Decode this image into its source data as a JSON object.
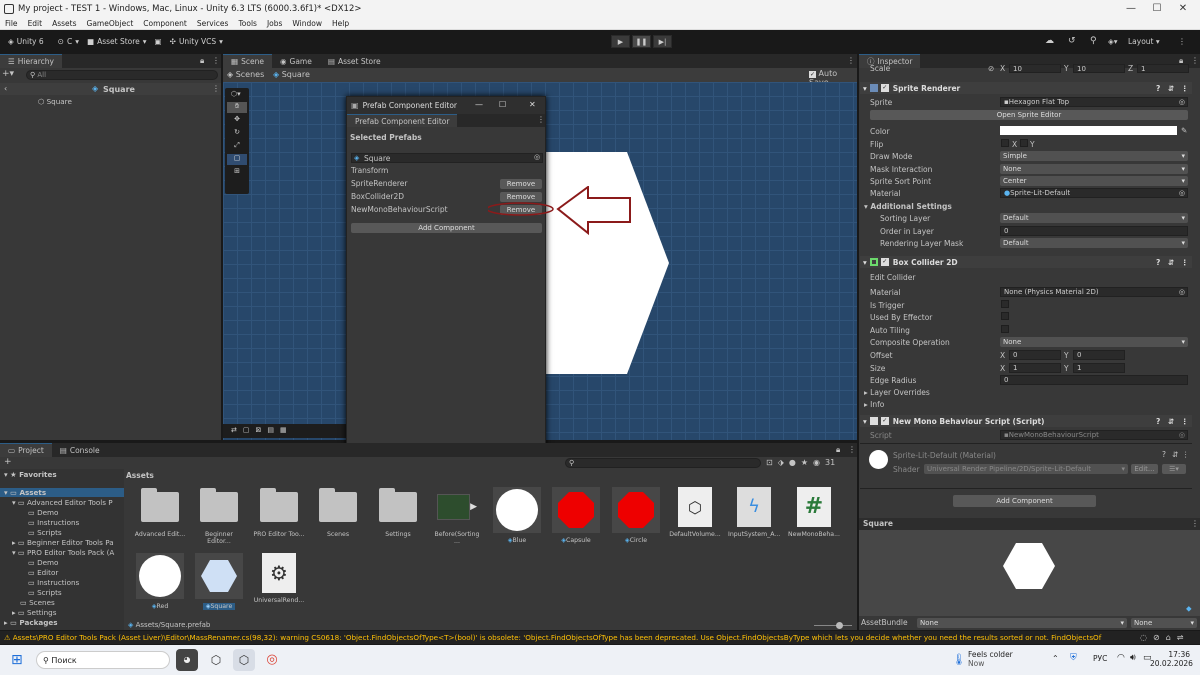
{
  "window": {
    "title": "My project - TEST 1 - Windows, Mac, Linux - Unity 6.3 LTS (6000.3.6f1)* <DX12>"
  },
  "menu": [
    "File",
    "Edit",
    "Assets",
    "GameObject",
    "Component",
    "Services",
    "Tools",
    "Jobs",
    "Window",
    "Help"
  ],
  "toolbar": {
    "unity": "Unity 6",
    "account": "C",
    "asset_store": "Asset Store",
    "vcs": "Unity VCS",
    "layout": "Layout"
  },
  "hierarchy": {
    "tab": "Hierarchy",
    "search": "All",
    "breadcrumb": "Square",
    "items": [
      "Square"
    ]
  },
  "scene": {
    "tabs": [
      "Scene",
      "Game",
      "Asset Store"
    ],
    "breadcrumb_scenes": "Scenes",
    "breadcrumb_obj": "Square",
    "auto_save": "Auto Save"
  },
  "dialog": {
    "title": "Prefab Component Editor",
    "tab": "Prefab Component Editor",
    "selected_label": "Selected Prefabs",
    "prefab": "Square",
    "components": [
      "Transform",
      "SpriteRenderer",
      "BoxCollider2D",
      "NewMonoBehaviourScript"
    ],
    "remove": "Remove",
    "add": "Add Component"
  },
  "project": {
    "tabs": [
      "Project",
      "Console"
    ],
    "breadcrumb": "Assets",
    "count": "31",
    "tree": [
      "Favorites",
      "Assets",
      "Advanced Editor Tools P",
      "Demo",
      "Instructions",
      "Scripts",
      "Beginner Editor Tools Pa",
      "PRO Editor Tools Pack (A",
      "Demo",
      "Editor",
      "Instructions",
      "Scripts",
      "Scenes",
      "Settings",
      "Packages"
    ],
    "assets": [
      "Advanced Edit...",
      "Beginner Editor...",
      "PRO Editor Too...",
      "Scenes",
      "Settings",
      "Before(Sorting ...",
      "Blue",
      "Capsule",
      "Circle",
      "DefaultVolume...",
      "InputSystem_A...",
      "NewMonoBeha...",
      "Red",
      "Square",
      "UniversalRend..."
    ],
    "footer": "Assets/Square.prefab"
  },
  "inspector": {
    "tab": "Inspector",
    "scale_label": "Scale",
    "scale": {
      "x": "10",
      "y": "10",
      "z": "1"
    },
    "sprite_renderer": {
      "title": "Sprite Renderer",
      "sprite_label": "Sprite",
      "sprite": "Hexagon Flat Top",
      "open_btn": "Open Sprite Editor",
      "color_label": "Color",
      "flip_label": "Flip",
      "flip_x": "X",
      "flip_y": "Y",
      "draw_mode_label": "Draw Mode",
      "draw_mode": "Simple",
      "mask_label": "Mask Interaction",
      "mask": "None",
      "sort_point_label": "Sprite Sort Point",
      "sort_point": "Center",
      "material_label": "Material",
      "material": "Sprite-Lit-Default",
      "additional": "Additional Settings",
      "sorting_layer_label": "Sorting Layer",
      "sorting_layer": "Default",
      "order_label": "Order in Layer",
      "order": "0",
      "rendering_layer_label": "Rendering Layer Mask",
      "rendering_layer": "Default"
    },
    "box_collider": {
      "title": "Box Collider 2D",
      "edit": "Edit Collider",
      "material_label": "Material",
      "material": "None (Physics Material 2D)",
      "trigger": "Is Trigger",
      "effector": "Used By Effector",
      "tiling": "Auto Tiling",
      "composite_label": "Composite Operation",
      "composite": "None",
      "offset_label": "Offset",
      "offset_x": "0",
      "offset_y": "0",
      "size_label": "Size",
      "size_x": "1",
      "size_y": "1",
      "edge_label": "Edge Radius",
      "edge": "0",
      "layer_overrides": "Layer Overrides",
      "info": "Info"
    },
    "script": {
      "title": "New Mono Behaviour Script (Script)",
      "script_label": "Script",
      "script": "NewMonoBehaviourScript"
    },
    "mat": {
      "name": "Sprite-Lit-Default (Material)",
      "shader_label": "Shader",
      "shader": "Universal Render Pipeline/2D/Sprite-Lit-Default",
      "edit": "Edit..."
    },
    "add_component": "Add Component",
    "preview_title": "Square",
    "asset_bundle_label": "AssetBundle",
    "bundle1": "None",
    "bundle2": "None"
  },
  "console_msg": "Assets\\PRO Editor Tools Pack (Asset Liver)\\Editor\\MassRenamer.cs(98,32): warning CS0618: 'Object.FindObjectsOfType<T>(bool)' is obsolete: 'Object.FindObjectsOfType has been deprecated. Use Object.FindObjectsByType which lets you decide whether you need the results sorted or not.  FindObjectsOf",
  "taskbar": {
    "search": "Поиск",
    "weather": "Feels colder",
    "weather_sub": "Now",
    "lang": "РУС",
    "time": "17:36",
    "date": "20.02.2026"
  }
}
